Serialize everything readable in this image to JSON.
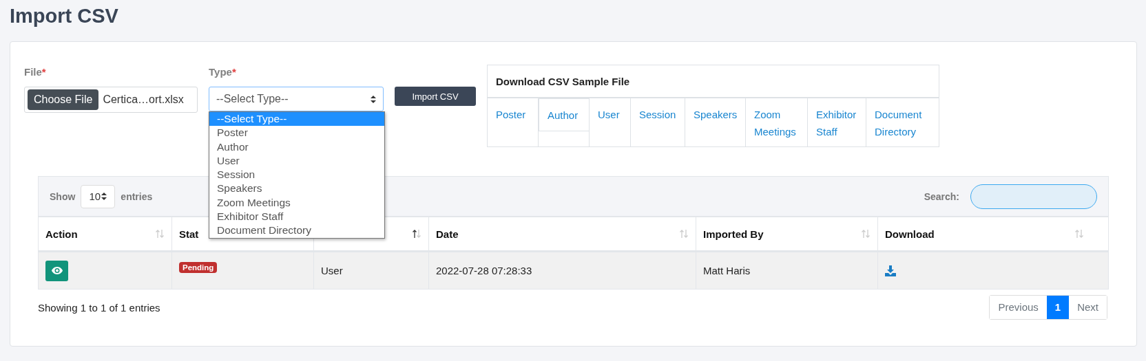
{
  "page_title": "Import CSV",
  "form": {
    "file": {
      "label": "File",
      "required_mark": "*",
      "button": "Choose File",
      "file_name": "Certica…ort.xlsx"
    },
    "type": {
      "label": "Type",
      "required_mark": "*",
      "value": "--Select Type--",
      "expanded": true,
      "options": [
        {
          "label": "--Select Type--",
          "selected": true
        },
        {
          "label": "Poster",
          "selected": false
        },
        {
          "label": "Author",
          "selected": false
        },
        {
          "label": "User",
          "selected": false
        },
        {
          "label": "Session",
          "selected": false
        },
        {
          "label": "Speakers",
          "selected": false
        },
        {
          "label": "Zoom Meetings",
          "selected": false
        },
        {
          "label": "Exhibitor Staff",
          "selected": false
        },
        {
          "label": "Document Directory",
          "selected": false
        }
      ]
    },
    "import_button": "Import CSV"
  },
  "samples": {
    "title": "Download CSV Sample File",
    "links": [
      {
        "label": "Poster",
        "selected": false
      },
      {
        "label": "Author",
        "selected": true
      },
      {
        "label": "User",
        "selected": false
      },
      {
        "label": "Session",
        "selected": false
      },
      {
        "label": "Speakers",
        "selected": false
      },
      {
        "label": "Zoom Meetings",
        "selected": false
      },
      {
        "label": "Exhibitor Staff",
        "selected": false
      },
      {
        "label": "Document Directory",
        "selected": false
      }
    ]
  },
  "table": {
    "show_label": "Show",
    "page_size": "10",
    "entries_label": "entries",
    "search_label": "Search:",
    "columns": [
      {
        "label": "Action",
        "sorted": false
      },
      {
        "label": "Stat"
      },
      {
        "sorted": true
      },
      {
        "label": "Date",
        "sorted": false
      },
      {
        "label": "Imported By",
        "sorted": false
      },
      {
        "label": "Download",
        "sorted": false
      }
    ],
    "rows": [
      {
        "status": "Pending",
        "type": "User",
        "date": "2022-07-28 07:28:33",
        "imported_by": "Matt Haris"
      }
    ],
    "info": "Showing 1 to 1 of 1 entries",
    "pagination": {
      "previous": "Previous",
      "pages": [
        {
          "label": "1",
          "selected": true
        }
      ],
      "next": "Next"
    }
  }
}
